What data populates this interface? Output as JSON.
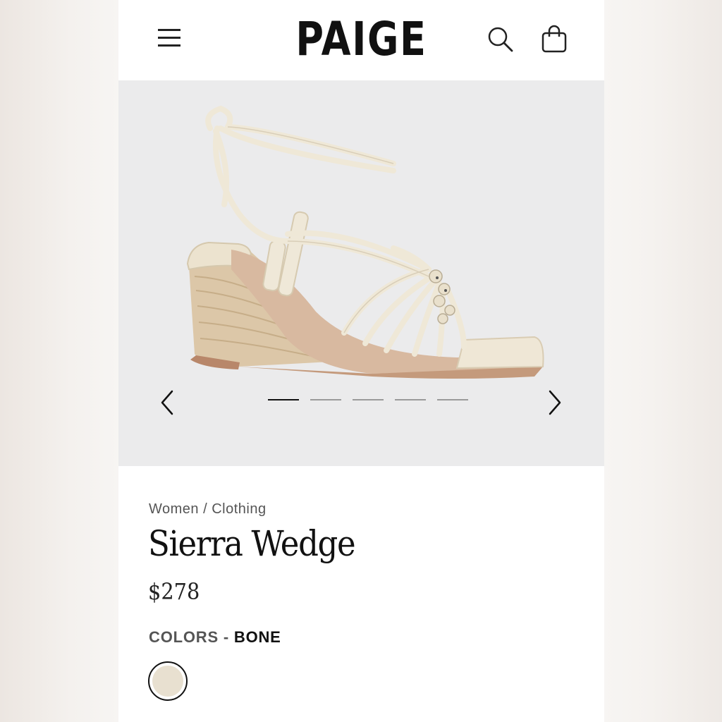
{
  "header": {
    "brand": "PAIGE",
    "icons": [
      "menu-icon",
      "search-icon",
      "shopping-bag-icon"
    ]
  },
  "gallery": {
    "image_alt": "Sierra Wedge sandal in bone",
    "icons": [
      "chevron-left-icon",
      "chevron-right-icon"
    ],
    "slide_count": 5,
    "active_slide": 1
  },
  "product": {
    "breadcrumb": "Women / Clothing",
    "name": "Sierra Wedge",
    "price": "$278",
    "colors_label": "COLORS -",
    "selected_color": "BONE",
    "swatch_color": "#e8e0d0"
  },
  "colors": {
    "page_bg": "#ffffff",
    "gallery_bg": "#ebebec",
    "text_primary": "#111111",
    "text_secondary": "#555555"
  }
}
